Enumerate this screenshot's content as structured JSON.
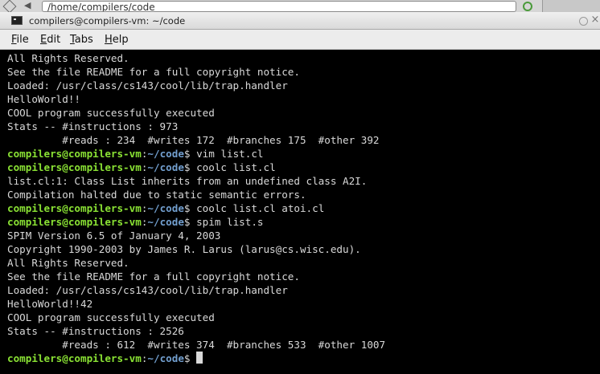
{
  "background_window": {
    "address_text": "/home/compilers/code"
  },
  "window": {
    "title": "compilers@compilers-vm: ~/code",
    "buttons": {
      "minimize_icon": "circle-icon",
      "close_icon": "×"
    }
  },
  "menu": {
    "items": [
      {
        "label": "File",
        "mnemonic": "F",
        "rest": "ile"
      },
      {
        "label": "Edit",
        "mnemonic": "E",
        "rest": "dit"
      },
      {
        "label": "Tabs",
        "mnemonic": "T",
        "rest": "abs"
      },
      {
        "label": "Help",
        "mnemonic": "H",
        "rest": "elp"
      }
    ]
  },
  "prompt": {
    "user_host": "compilers@compilers-vm",
    "sep": ":",
    "path": "~/code",
    "symbol": "$"
  },
  "colors": {
    "user_host": "#8ae234",
    "path": "#729fcf",
    "text": "#d9d9d9",
    "background": "#000000"
  },
  "terminal": {
    "lines": [
      {
        "type": "out",
        "text": "All Rights Reserved."
      },
      {
        "type": "out",
        "text": "See the file README for a full copyright notice."
      },
      {
        "type": "out",
        "text": "Loaded: /usr/class/cs143/cool/lib/trap.handler"
      },
      {
        "type": "out",
        "text": "HelloWorld!!"
      },
      {
        "type": "out",
        "text": "COOL program successfully executed"
      },
      {
        "type": "out",
        "text": "Stats -- #instructions : 973"
      },
      {
        "type": "out",
        "text": "         #reads : 234  #writes 172  #branches 175  #other 392"
      },
      {
        "type": "cmd",
        "text": " vim list.cl"
      },
      {
        "type": "cmd",
        "text": " coolc list.cl"
      },
      {
        "type": "out",
        "text": "list.cl:1: Class List inherits from an undefined class A2I."
      },
      {
        "type": "out",
        "text": "Compilation halted due to static semantic errors."
      },
      {
        "type": "cmd",
        "text": " coolc list.cl atoi.cl"
      },
      {
        "type": "cmd",
        "text": " spim list.s"
      },
      {
        "type": "out",
        "text": "SPIM Version 6.5 of January 4, 2003"
      },
      {
        "type": "out",
        "text": "Copyright 1990-2003 by James R. Larus (larus@cs.wisc.edu)."
      },
      {
        "type": "out",
        "text": "All Rights Reserved."
      },
      {
        "type": "out",
        "text": "See the file README for a full copyright notice."
      },
      {
        "type": "out",
        "text": "Loaded: /usr/class/cs143/cool/lib/trap.handler"
      },
      {
        "type": "out",
        "text": "HelloWorld!!42"
      },
      {
        "type": "out",
        "text": "COOL program successfully executed"
      },
      {
        "type": "out",
        "text": "Stats -- #instructions : 2526"
      },
      {
        "type": "out",
        "text": "         #reads : 612  #writes 374  #branches 533  #other 1007"
      },
      {
        "type": "cmd",
        "text": " ",
        "cursor": true
      }
    ]
  }
}
